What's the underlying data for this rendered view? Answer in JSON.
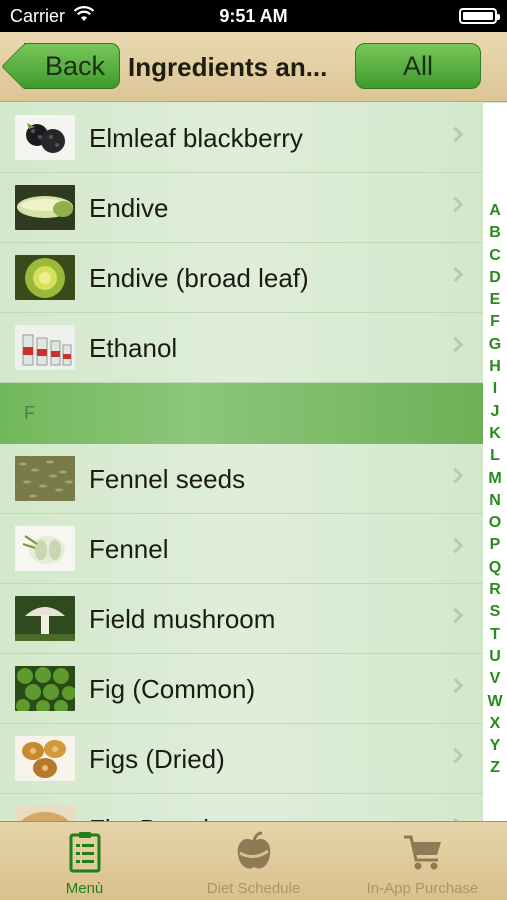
{
  "status_bar": {
    "carrier": "Carrier",
    "time": "9:51 AM"
  },
  "nav": {
    "back_label": "Back",
    "title": "Ingredients an...",
    "all_label": "All"
  },
  "list": {
    "rows_before": [
      {
        "name": "Elmleaf blackberry",
        "thumb": "blackberry"
      },
      {
        "name": "Endive",
        "thumb": "endive"
      },
      {
        "name": "Endive (broad leaf)",
        "thumb": "endive-broad"
      },
      {
        "name": "Ethanol",
        "thumb": "ethanol"
      }
    ],
    "section_header": "F",
    "rows_after": [
      {
        "name": "Fennel seeds",
        "thumb": "fennel-seeds"
      },
      {
        "name": "Fennel",
        "thumb": "fennel"
      },
      {
        "name": "Field mushroom",
        "thumb": "mushroom"
      },
      {
        "name": "Fig (Common)",
        "thumb": "fig"
      },
      {
        "name": "Figs (Dried)",
        "thumb": "dried-figs"
      },
      {
        "name": "Flat Bread",
        "thumb": "flat-bread"
      }
    ]
  },
  "index_letters": [
    "A",
    "B",
    "C",
    "D",
    "E",
    "F",
    "G",
    "H",
    "I",
    "J",
    "K",
    "L",
    "M",
    "N",
    "O",
    "P",
    "Q",
    "R",
    "S",
    "T",
    "U",
    "V",
    "W",
    "X",
    "Y",
    "Z"
  ],
  "tabs": [
    {
      "label": "Menù",
      "icon": "menu-list-icon",
      "active": true
    },
    {
      "label": "Diet Schedule",
      "icon": "apple-tape-icon",
      "active": false
    },
    {
      "label": "In-App Purchase",
      "icon": "cart-icon",
      "active": false
    }
  ],
  "colors": {
    "accent_green": "#3e9a2b",
    "index_green": "#2b8a1f",
    "nav_tan": "#dcc594"
  }
}
